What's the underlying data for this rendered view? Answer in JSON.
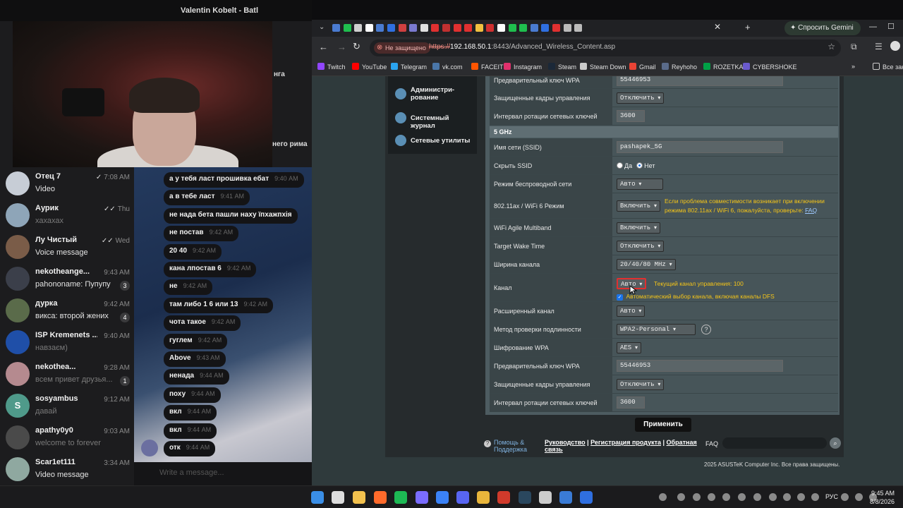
{
  "telegram": {
    "window_title": "Valentin Kobelt - Batl",
    "overlay_fragments": [
      "нга",
      "него рима"
    ],
    "chats": [
      {
        "name": "Отец 7",
        "preview": "Video",
        "time": "7:08 AM",
        "avatar_color": "#c7cdd6",
        "check": "✓",
        "preview_dim": false
      },
      {
        "name": "Аурик",
        "preview": "хахахах",
        "time": "Thu",
        "avatar_color": "#8ea5b8",
        "check": "✓✓",
        "preview_dim": true
      },
      {
        "name": "Лу Чистый",
        "preview": "Voice message",
        "time": "Wed",
        "avatar_color": "#7a5c48",
        "check": "✓✓",
        "preview_dim": false
      },
      {
        "name": "nekotheange...",
        "preview": "pahononame: Пупупу",
        "time": "9:43 AM",
        "avatar_color": "#3b3f4a",
        "count": "3",
        "preview_dim": false
      },
      {
        "name": "дурка",
        "preview": "викса: второй жених",
        "time": "9:42 AM",
        "avatar_color": "#5a6b4a",
        "count": "4",
        "preview_dim": false
      },
      {
        "name": "ISP Kremenets ...",
        "preview": "навзаєм)",
        "time": "9:40 AM",
        "avatar_color": "#1f4fa8",
        "preview_dim": true
      },
      {
        "name": "nekothea...",
        "preview": "всем привет друзья...",
        "time": "9:28 AM",
        "avatar_color": "#b58a8f",
        "count": "1",
        "preview_dim": true
      },
      {
        "name": "sosyambus",
        "preview": "давай",
        "time": "9:12 AM",
        "avatar_color": "#4f9a8a",
        "avatar_letter": "S",
        "preview_dim": true
      },
      {
        "name": "apathy0y0",
        "preview": "welcome to forever",
        "time": "9:03 AM",
        "avatar_color": "#4a4a4a",
        "preview_dim": true
      },
      {
        "name": "Scar1et111",
        "preview": "Video message",
        "time": "3:34 AM",
        "avatar_color": "#8fa8a0",
        "preview_dim": false
      }
    ],
    "messages": [
      {
        "text": "а у тебя ласт прошивка ебат",
        "time": "9:40 AM"
      },
      {
        "text": "а в тебе ласт",
        "time": "9:41 AM"
      },
      {
        "text": "не нада бета пашли наху їпхажпхія",
        "time": ""
      },
      {
        "text": "не постав",
        "time": "9:42 AM"
      },
      {
        "text": "20 40",
        "time": "9:42 AM"
      },
      {
        "text": "кана лпостав 6",
        "time": "9:42 AM"
      },
      {
        "text": "не",
        "time": "9:42 AM"
      },
      {
        "text": "там либо 1 6 или 13",
        "time": "9:42 AM"
      },
      {
        "text": "чота такое",
        "time": "9:42 AM"
      },
      {
        "text": "гуглем",
        "time": "9:42 AM"
      },
      {
        "text": "Above",
        "time": "9:43 AM"
      },
      {
        "text": "ненада",
        "time": "9:44 AM"
      },
      {
        "text": "поху",
        "time": "9:44 AM"
      },
      {
        "text": "вкл",
        "time": "9:44 AM"
      },
      {
        "text": "вкл",
        "time": "9:44 AM"
      },
      {
        "text": "отк",
        "time": "9:44 AM"
      }
    ],
    "input_placeholder": "Write a message..."
  },
  "browser": {
    "gemini_label": "Спросить Gemini",
    "security_label": "Не защищено",
    "url_scheme": "https://",
    "url_host": "192.168.50.1",
    "url_rest": ":8443/Advanced_Wireless_Content.asp",
    "bookmarks": [
      "Twitch",
      "YouTube",
      "Telegram",
      "vk.com",
      "FACEIT",
      "Instagram",
      "Steam",
      "Steam Down",
      "Gmail",
      "Reyhoho",
      "ROZETKA",
      "CYBERSHOKE"
    ],
    "all_bookmarks": "Все закл"
  },
  "router": {
    "menu": [
      {
        "label_line1": "Администри-",
        "label_line2": "рование"
      },
      {
        "label_line1": "Системный журнал",
        "label_line2": ""
      },
      {
        "label_line1": "Сетевые утилиты",
        "label_line2": ""
      }
    ],
    "top_rows": {
      "wpa_key_label": "Предварительный ключ WPA",
      "wpa_key_value": "55446953",
      "pmf_label": "Защищенные кадры управления",
      "pmf_value": "Отключить",
      "rotation_label": "Интервал ротации сетевых ключей",
      "rotation_value": "3600"
    },
    "section_5g": "5 GHz",
    "ssid_label": "Имя сети (SSID)",
    "ssid_value": "pashapek_5G",
    "hide_ssid_label": "Скрыть SSID",
    "hide_yes": "Да",
    "hide_no": "Нет",
    "mode_label": "Режим беспроводной сети",
    "mode_value": "Авто",
    "ax_label": "802.11ax / WiFi 6 Режим",
    "ax_value": "Включить",
    "ax_note": "Если проблема совместимости возникает при включении режима 802.11ax / WiFi 6, пожалуйста, проверьте:",
    "ax_note_link": "FAQ",
    "agile_label": "WiFi Agile Multiband",
    "agile_value": "Включить",
    "twt_label": "Target Wake Time",
    "twt_value": "Отключить",
    "width_label": "Ширина канала",
    "width_value": "20/40/80 MHz",
    "channel_label": "Канал",
    "channel_value": "Авто",
    "channel_note": "Текущий канал управления: 100",
    "dfs_note": "Автоматический выбор канала, включая каналы DFS",
    "ext_label": "Расширенный канал",
    "ext_value": "Авто",
    "auth_label": "Метод проверки подлинности",
    "auth_value": "WPA2-Personal",
    "enc_label": "Шифрование WPA",
    "enc_value": "AES",
    "key_label": "Предварительный ключ WPA",
    "key_value": "55446953",
    "pmf2_label": "Защищенные кадры управления",
    "pmf2_value": "Отключить",
    "rot2_label": "Интервал ротации сетевых ключей",
    "rot2_value": "3600",
    "apply_label": "Применить",
    "help_line1": "Помощь &",
    "help_line2": "Поддержка",
    "footer_manual": "Руководство",
    "footer_reg": "Регистрация продукта",
    "footer_feedback1": "Обратная",
    "footer_feedback2": "связь",
    "faq_label": "FAQ",
    "copyright": "2025 ASUSTeK Computer Inc. Все права защищены."
  },
  "taskbar": {
    "lang": "РУС",
    "time": "9:45 AM",
    "date": "8/8/2026"
  }
}
